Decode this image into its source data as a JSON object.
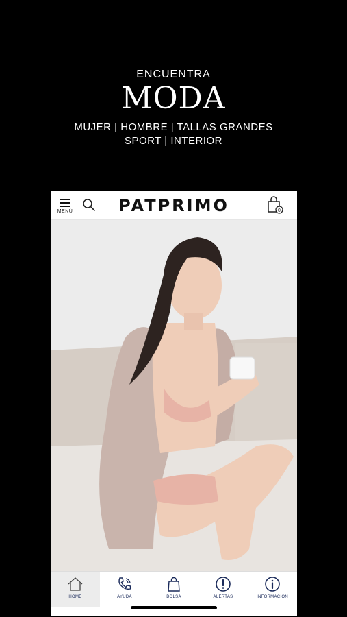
{
  "promo": {
    "eyebrow": "ENCUENTRA",
    "title": "MODA",
    "line1": "MUJER | HOMBRE | TALLAS GRANDES",
    "line2": "SPORT | INTERIOR"
  },
  "header": {
    "menu_label": "MENÚ",
    "brand": "PATPRIMO",
    "bag_count": "0"
  },
  "tabs": [
    {
      "label": "HOME",
      "icon": "home-icon"
    },
    {
      "label": "AYUDA",
      "icon": "phone-icon"
    },
    {
      "label": "BOLSA",
      "icon": "bag-icon"
    },
    {
      "label": "ALERTAS",
      "icon": "alert-icon"
    },
    {
      "label": "INFORMACIÓN",
      "icon": "info-icon"
    }
  ],
  "colors": {
    "background": "#000000",
    "tab_icon": "#1a2a5a",
    "active_tab_bg": "#ececec"
  }
}
